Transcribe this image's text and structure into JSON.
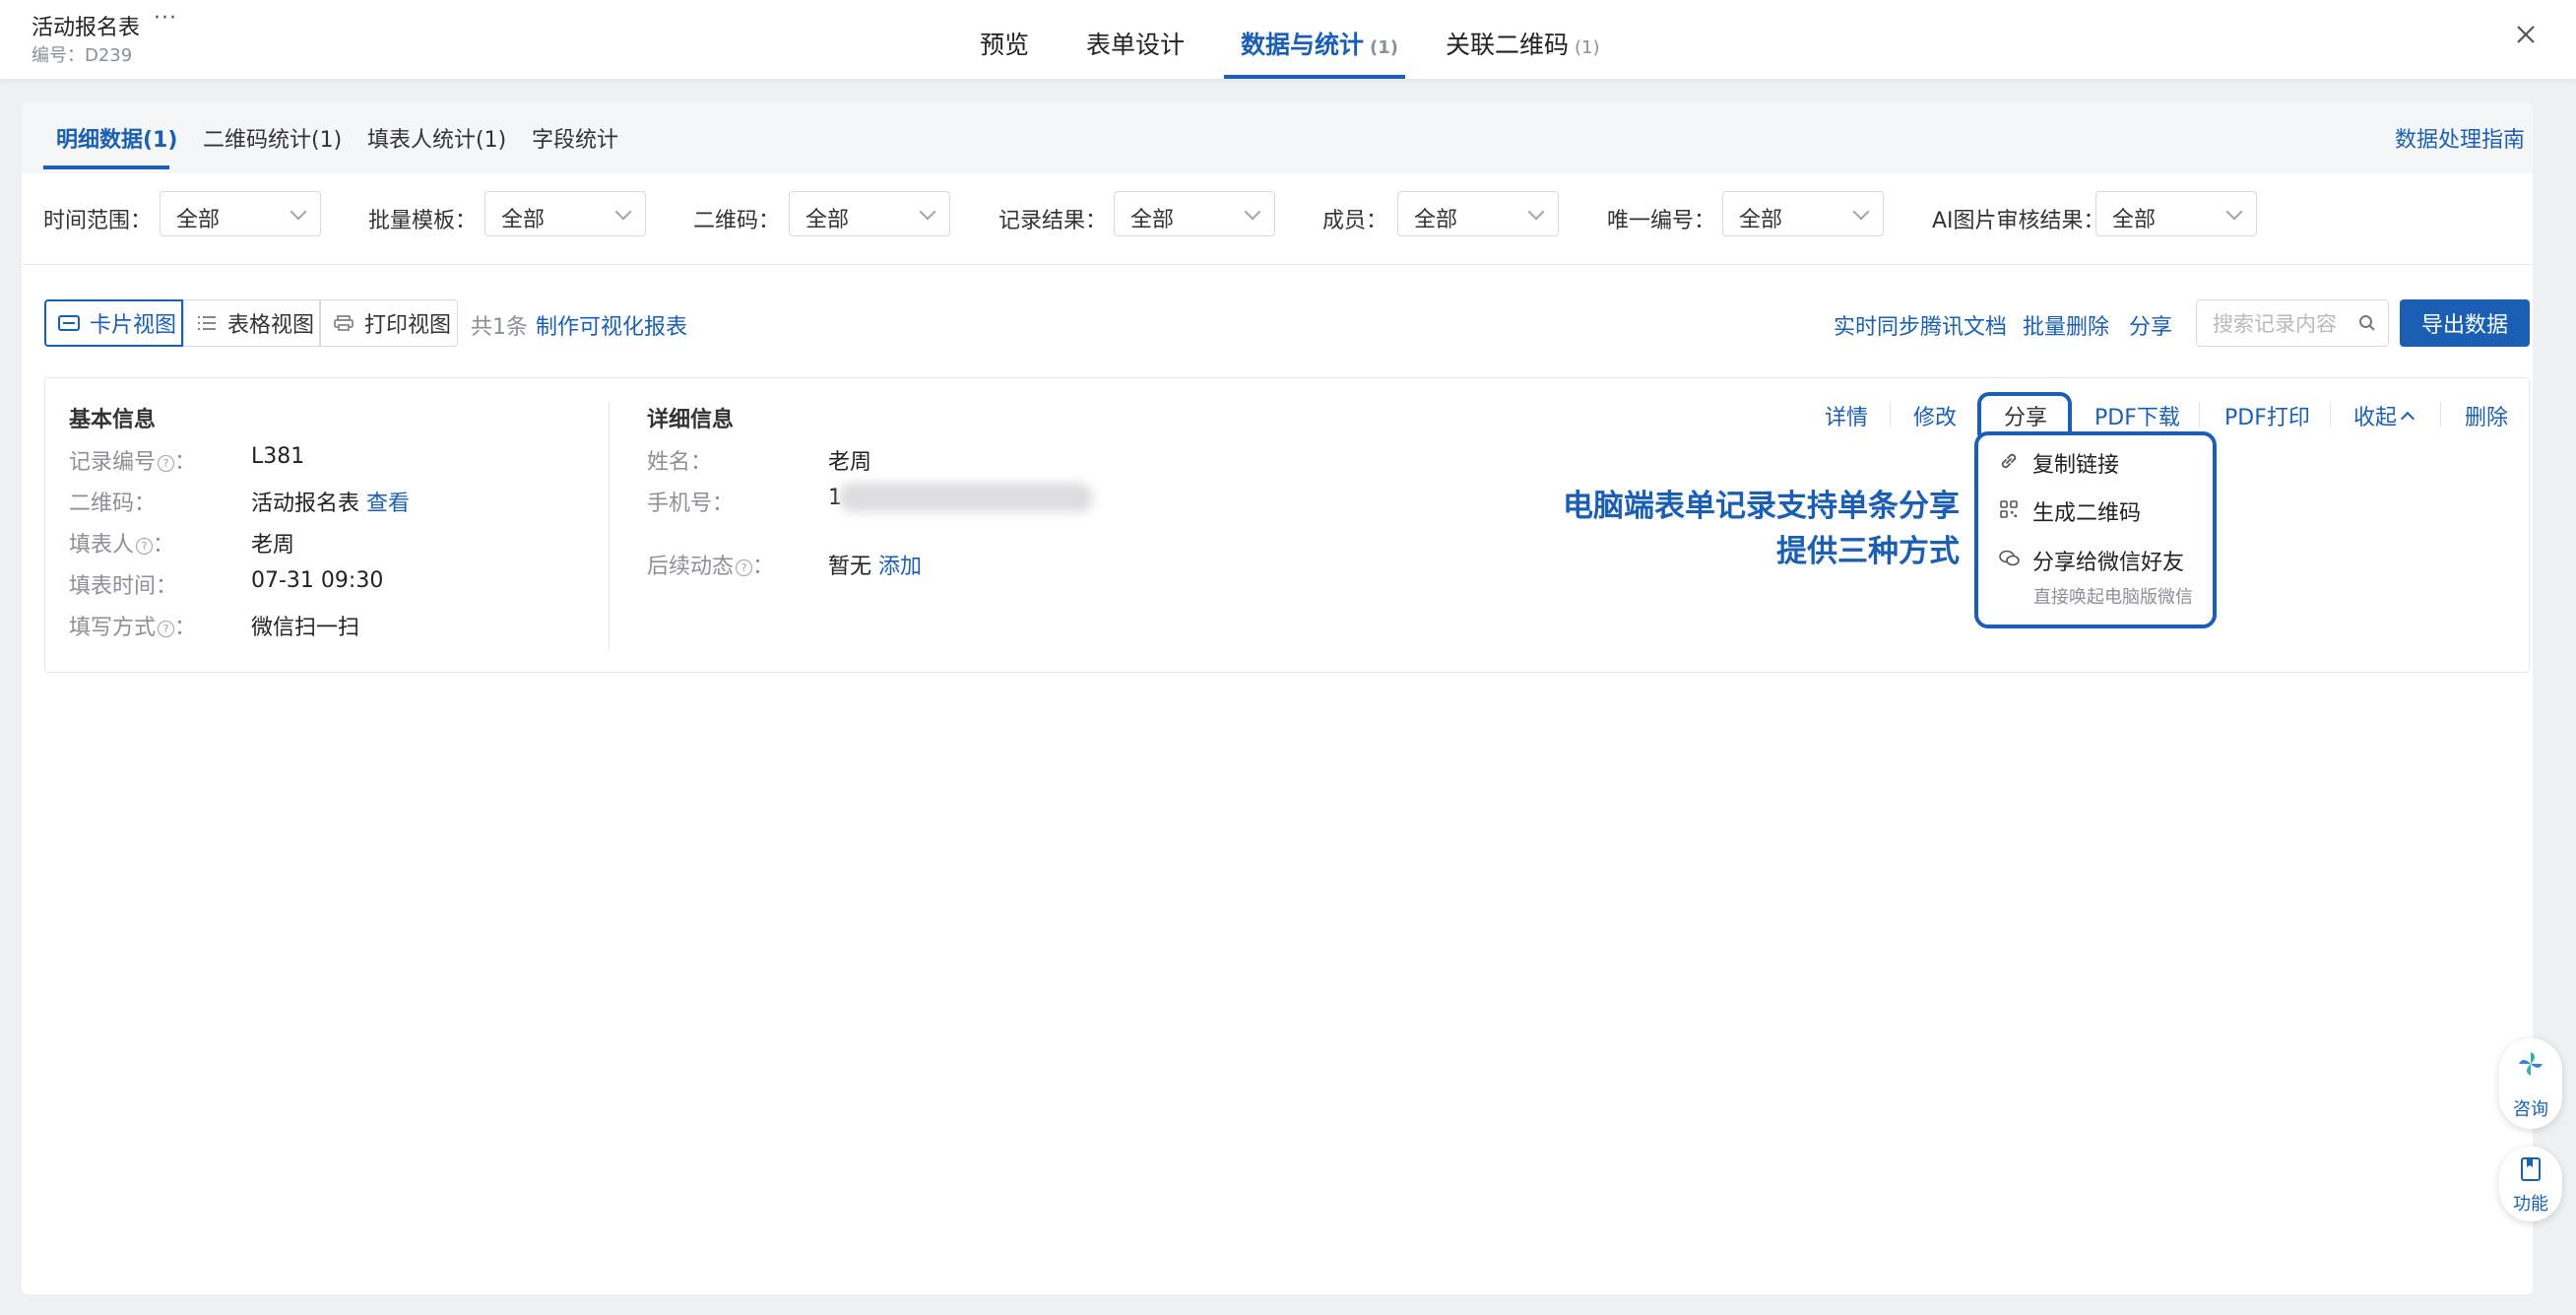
{
  "app": {
    "title": "活动报名表",
    "more": "···",
    "id_label": "编号：D239"
  },
  "main_tabs": [
    {
      "label": "预览",
      "count": ""
    },
    {
      "label": "表单设计",
      "count": ""
    },
    {
      "label": "数据与统计",
      "count": "(1)"
    },
    {
      "label": "关联二维码",
      "count": "(1)"
    }
  ],
  "sub_tabs": [
    "明细数据(1)",
    "二维码统计(1)",
    "填表人统计(1)",
    "字段统计"
  ],
  "guide_link": "数据处理指南",
  "filters": [
    {
      "label": "时间范围：",
      "value": "全部"
    },
    {
      "label": "批量模板：",
      "value": "全部"
    },
    {
      "label": "二维码：",
      "value": "全部"
    },
    {
      "label": "记录结果：",
      "value": "全部"
    },
    {
      "label": "成员：",
      "value": "全部"
    },
    {
      "label": "唯一编号：",
      "value": "全部"
    },
    {
      "label": "AI图片审核结果：",
      "value": "全部"
    }
  ],
  "views": [
    "卡片视图",
    "表格视图",
    "打印视图"
  ],
  "count_text": "共1条",
  "report_link": "制作可视化报表",
  "toolbar": {
    "sync": "实时同步腾讯文档",
    "batch_delete": "批量删除",
    "share": "分享",
    "export": "导出数据"
  },
  "search": {
    "placeholder": "搜索记录内容"
  },
  "card": {
    "basic_title": "基本信息",
    "basic": [
      {
        "label": "记录编号",
        "help": true,
        "value": "L381"
      },
      {
        "label": "二维码",
        "help": false,
        "value": "活动报名表",
        "link": "查看"
      },
      {
        "label": "填表人",
        "help": true,
        "value": "老周"
      },
      {
        "label": "填表时间",
        "help": false,
        "value": "07-31 09:30"
      },
      {
        "label": "填写方式",
        "help": true,
        "value": "微信扫一扫"
      }
    ],
    "detail_title": "详细信息",
    "detail": [
      {
        "label": "姓名：",
        "value": "老周"
      },
      {
        "label": "手机号：",
        "value": "1"
      },
      {
        "label": "后续动态",
        "value": "暂无",
        "link": "添加"
      }
    ],
    "actions": [
      "详情",
      "修改",
      "分享",
      "PDF下载",
      "PDF打印",
      "收起",
      "删除"
    ]
  },
  "share_menu": {
    "items": [
      "复制链接",
      "生成二维码",
      "分享给微信好友"
    ],
    "sub": "直接唤起电脑版微信"
  },
  "callout": [
    "电脑端表单记录支持单条分享",
    "提供三种方式"
  ],
  "float": {
    "consult": "咨询",
    "function": "功能"
  },
  "colors": {
    "accent": "#1a5fb4",
    "callout_border": "#1a5fb4"
  }
}
